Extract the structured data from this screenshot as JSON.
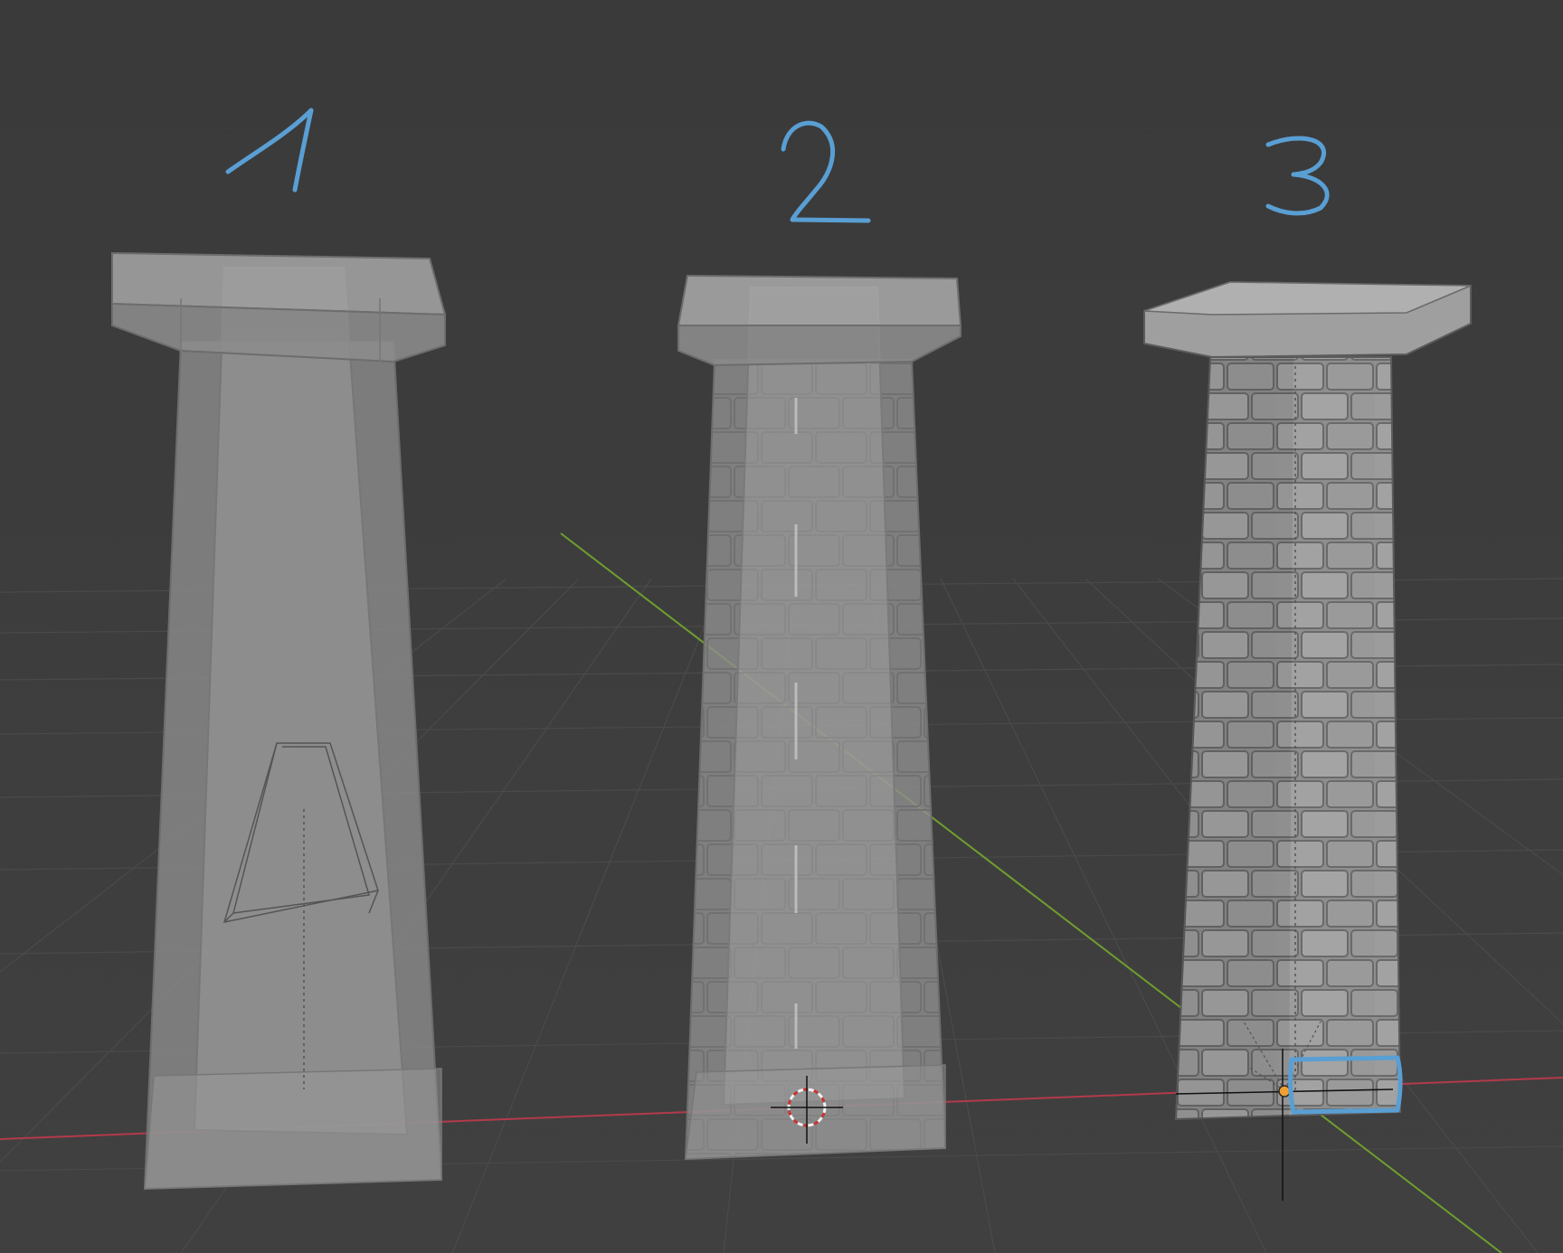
{
  "viewport": {
    "background": "#3d3d3d",
    "grid_color": "#484848",
    "axis_x_color": "#b33a4a",
    "axis_y_color": "#6f9e2e"
  },
  "annotations": {
    "color": "#5a9fd4",
    "labels": [
      "1",
      "2",
      "3"
    ]
  },
  "objects": [
    {
      "id": "pillar-1",
      "style": "plain tapered pillar, transparent",
      "has_bounding_wireframe": true
    },
    {
      "id": "pillar-2",
      "style": "brick pillar, transparent, inner body visible",
      "has_3d_cursor": true
    },
    {
      "id": "pillar-3",
      "style": "brick pillar, solid shading, selected origin",
      "has_highlight_box": true
    }
  ]
}
